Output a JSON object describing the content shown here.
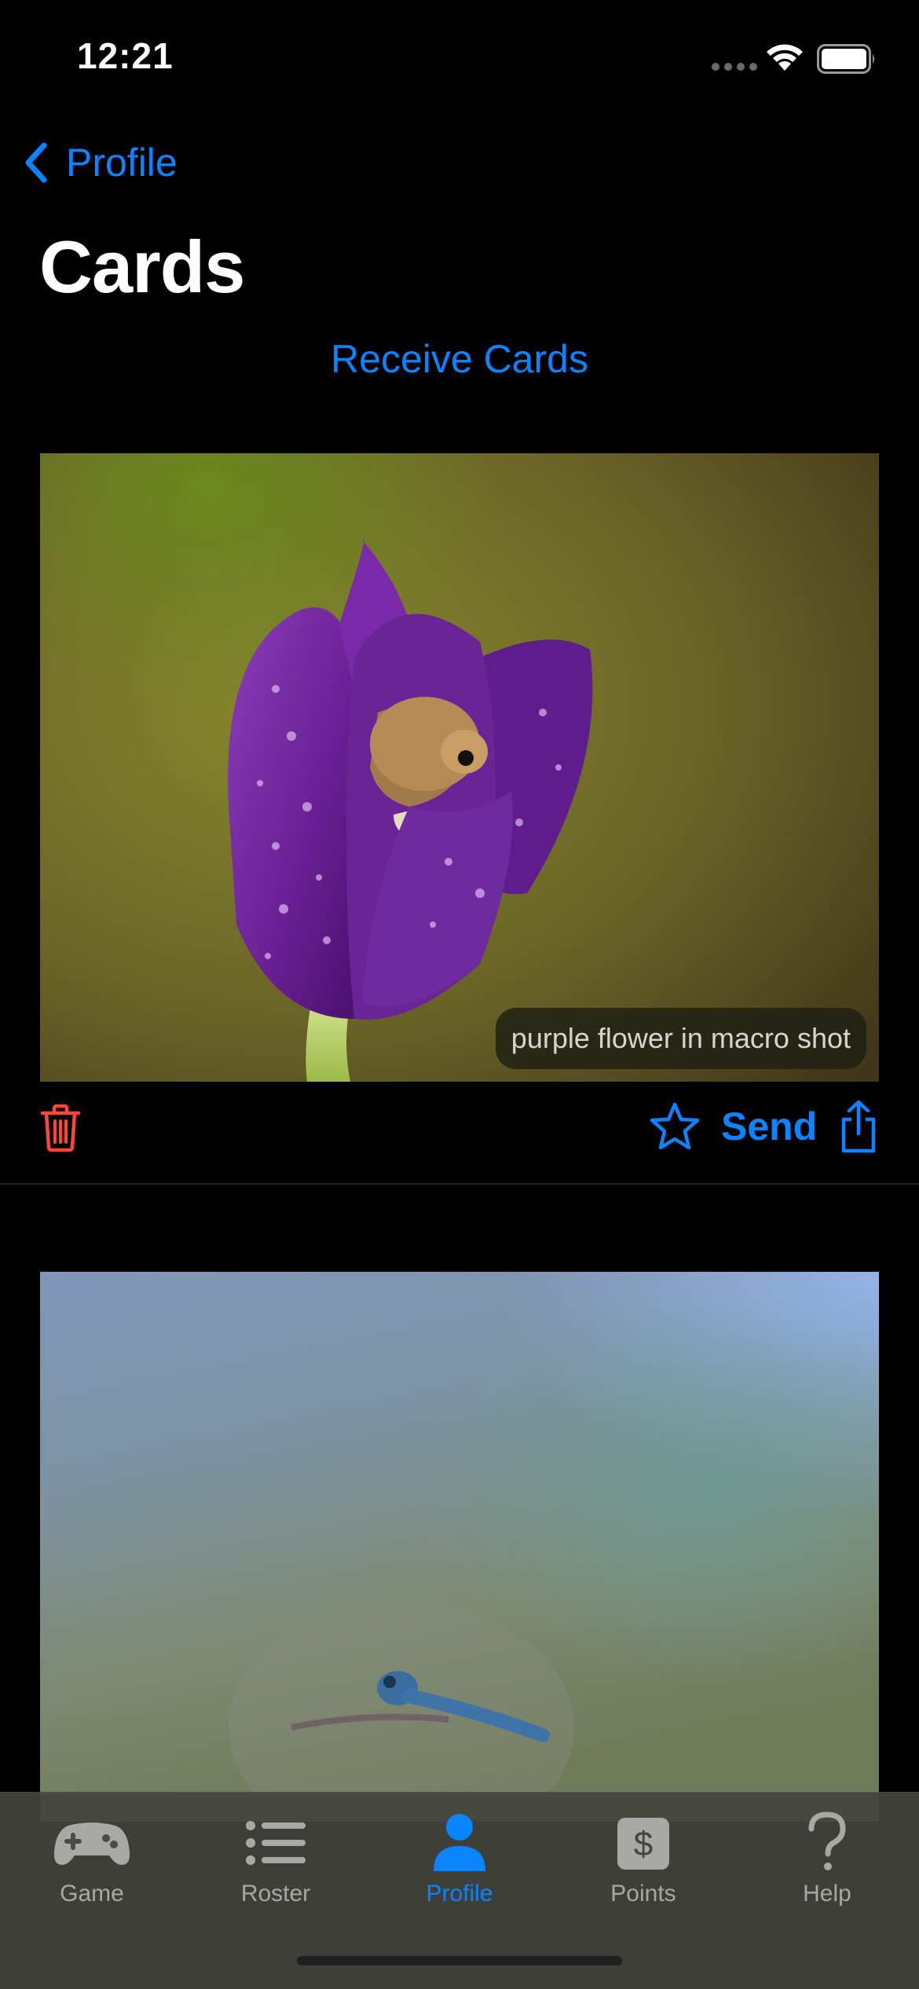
{
  "status_bar": {
    "time": "12:21"
  },
  "nav": {
    "back_label": "Profile",
    "title": "Cards",
    "receive_label": "Receive Cards"
  },
  "cards": [
    {
      "caption": "purple flower in macro shot",
      "send_label": "Send"
    }
  ],
  "tab_bar": {
    "tabs": [
      {
        "label": "Game",
        "icon": "gamecontroller-icon",
        "active": false
      },
      {
        "label": "Roster",
        "icon": "list-icon",
        "active": false
      },
      {
        "label": "Profile",
        "icon": "person-icon",
        "active": true
      },
      {
        "label": "Points",
        "icon": "dollar-icon",
        "active": false
      },
      {
        "label": "Help",
        "icon": "question-icon",
        "active": false
      }
    ]
  },
  "colors": {
    "accent": "#0a84ff",
    "destructive": "#ff453a",
    "background": "#000000",
    "tab_inactive": "#a8a8a4"
  }
}
